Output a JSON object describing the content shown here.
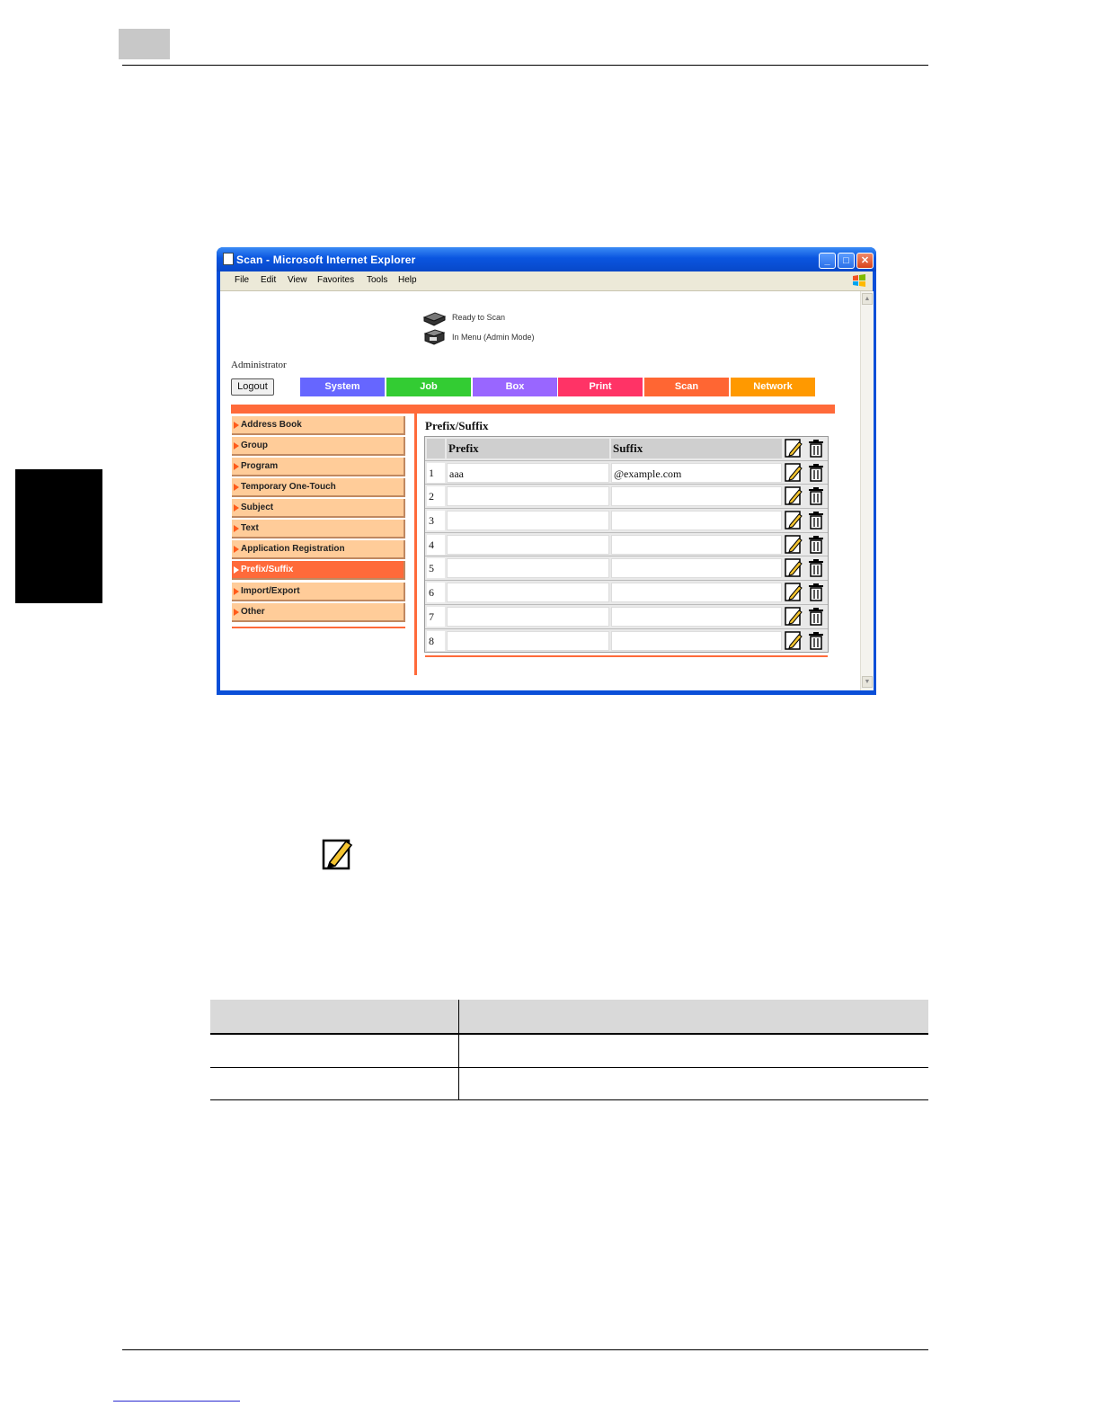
{
  "window": {
    "title": "Scan - Microsoft Internet Explorer",
    "controls": {
      "minimize": "_",
      "maximize": "□",
      "close": "✕"
    }
  },
  "menu": {
    "items": [
      "File",
      "Edit",
      "View",
      "Favorites",
      "Tools",
      "Help"
    ]
  },
  "status": {
    "line1": "Ready to Scan",
    "line2": "In Menu (Admin Mode)"
  },
  "user": {
    "role": "Administrator",
    "logout_label": "Logout"
  },
  "tabs": [
    {
      "label": "System",
      "color": "#6666ff"
    },
    {
      "label": "Job",
      "color": "#33cc33"
    },
    {
      "label": "Box",
      "color": "#9966ff"
    },
    {
      "label": "Print",
      "color": "#ff3366"
    },
    {
      "label": "Scan",
      "color": "#ff6633"
    },
    {
      "label": "Network",
      "color": "#ff9900"
    }
  ],
  "nav": {
    "items": [
      "Address Book",
      "Group",
      "Program",
      "Temporary One-Touch",
      "Subject",
      "Text",
      "Application Registration",
      "Prefix/Suffix",
      "Import/Export",
      "Other"
    ],
    "active": "Prefix/Suffix"
  },
  "content": {
    "title": "Prefix/Suffix",
    "columns": {
      "prefix": "Prefix",
      "suffix": "Suffix"
    },
    "rows": [
      {
        "no": "1",
        "prefix": "aaa",
        "suffix": "@example.com"
      },
      {
        "no": "2",
        "prefix": "",
        "suffix": ""
      },
      {
        "no": "3",
        "prefix": "",
        "suffix": ""
      },
      {
        "no": "4",
        "prefix": "",
        "suffix": ""
      },
      {
        "no": "5",
        "prefix": "",
        "suffix": ""
      },
      {
        "no": "6",
        "prefix": "",
        "suffix": ""
      },
      {
        "no": "7",
        "prefix": "",
        "suffix": ""
      },
      {
        "no": "8",
        "prefix": "",
        "suffix": ""
      }
    ]
  },
  "icons": {
    "edit": "edit-pencil-icon",
    "delete": "trash-icon",
    "status_scanner": "scanner-icon",
    "status_printer": "printer-icon"
  },
  "colors": {
    "accent": "#ff6a3a",
    "nav_bg": "#ffcc99",
    "titlebar": "#0a55e0"
  }
}
